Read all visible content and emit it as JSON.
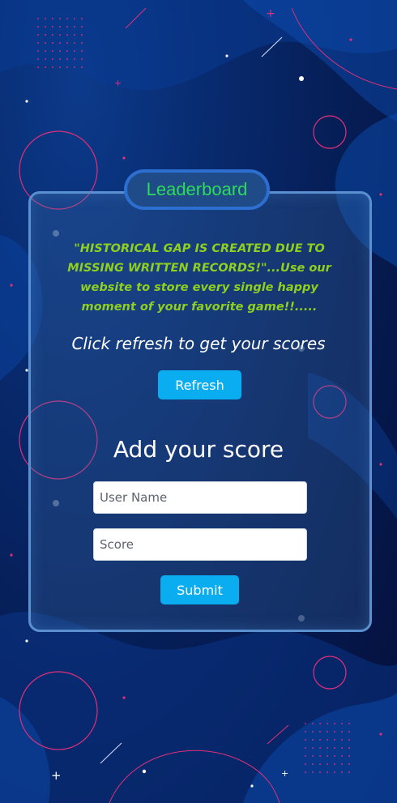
{
  "leaderboard": {
    "title": "Leaderboard",
    "quote": "\"HISTORICAL GAP IS CREATED DUE TO MISSING WRITTEN RECORDS!\"...Use our website to store every single happy moment of your favorite game!!.....",
    "refresh_prompt": "Click refresh to get your scores",
    "refresh_label": "Refresh"
  },
  "add_score": {
    "title": "Add your score",
    "user_name_placeholder": "User Name",
    "score_placeholder": "Score",
    "submit_label": "Submit"
  },
  "colors": {
    "title_green": "#2ddc58",
    "quote_green": "#8fcf1e",
    "button_blue": "#0aaef0",
    "accent_pink": "#e0307a",
    "background_navy": "#061d55"
  }
}
